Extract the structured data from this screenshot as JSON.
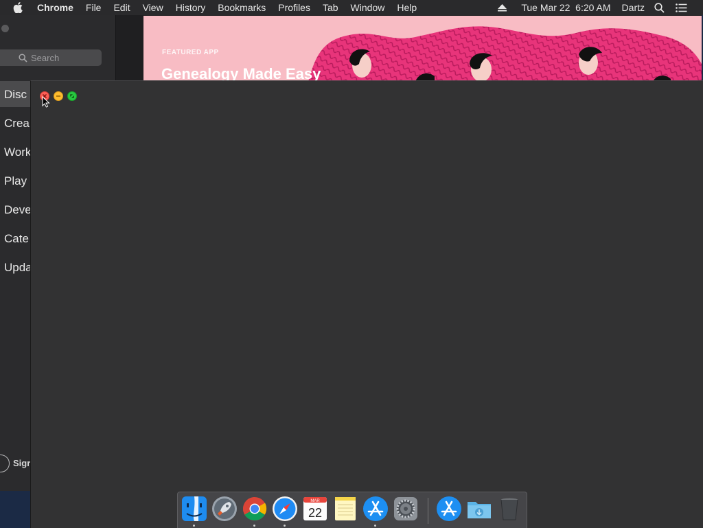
{
  "menubar": {
    "app_name": "Chrome",
    "items": [
      "File",
      "Edit",
      "View",
      "History",
      "Bookmarks",
      "Profiles",
      "Tab",
      "Window",
      "Help"
    ],
    "datetime": "Tue Mar 22  6:20 AM",
    "user": "Dartz",
    "icons": [
      "apple-icon",
      "eject-icon",
      "spotlight-search-icon",
      "notification-center-icon"
    ]
  },
  "appstore": {
    "search_placeholder": "Search",
    "nav": [
      "Disc",
      "Crea",
      "Work",
      "Play",
      "Deve",
      "Cate",
      "Upda"
    ],
    "signin": "Sigr",
    "featured": {
      "label": "FEATURED APP",
      "headline": "Genealogy Made Easy"
    },
    "banner_color": "#f8bcc4",
    "accent_pink": "#e8347a"
  },
  "chrome_window": {
    "background": "#323233",
    "controls": [
      "close-button",
      "minimize-button",
      "zoom-button"
    ]
  },
  "dock": {
    "apps": [
      "Finder",
      "Launchpad",
      "Google Chrome",
      "Safari",
      "Calendar",
      "Notes",
      "App Store",
      "System Preferences",
      "App Store",
      "Downloads",
      "Trash"
    ],
    "calendar": {
      "month": "MAR",
      "day": "22"
    },
    "running": [
      "Finder",
      "Launchpad",
      "Safari",
      "App Store"
    ]
  }
}
